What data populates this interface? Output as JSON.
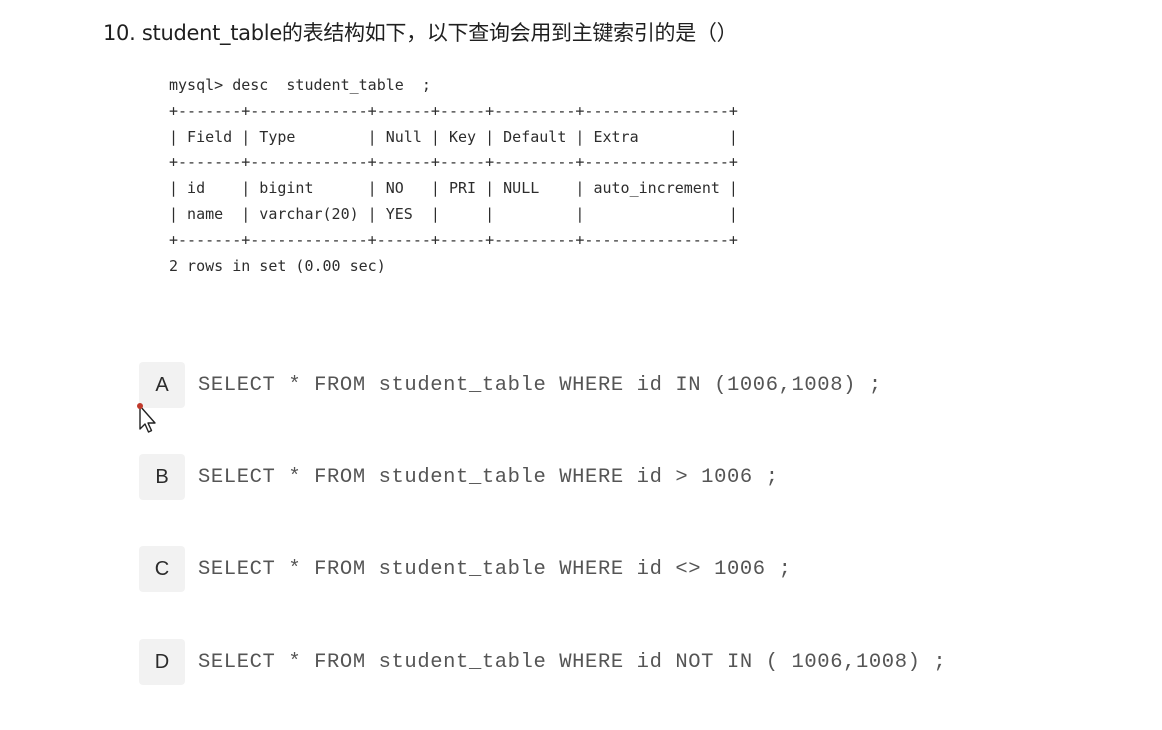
{
  "question": {
    "title": "10. student_table的表结构如下，以下查询会用到主键索引的是（）"
  },
  "console_output": {
    "lines": [
      "mysql> desc  student_table  ;",
      "+-------+-------------+------+-----+---------+----------------+",
      "| Field | Type        | Null | Key | Default | Extra          |",
      "+-------+-------------+------+-----+---------+----------------+",
      "| id    | bigint      | NO   | PRI | NULL    | auto_increment |",
      "| name  | varchar(20) | YES  |     |         |                |",
      "+-------+-------------+------+-----+---------+----------------+",
      "2 rows in set (0.00 sec)"
    ]
  },
  "options": [
    {
      "letter": "A",
      "text": "SELECT * FROM student_table WHERE id IN (1006,1008) ;"
    },
    {
      "letter": "B",
      "text": "SELECT * FROM student_table WHERE id > 1006 ;"
    },
    {
      "letter": "C",
      "text": "SELECT * FROM student_table WHERE id <> 1006 ;"
    },
    {
      "letter": "D",
      "text": "SELECT * FROM student_table WHERE id NOT IN ( 1006,1008) ;"
    }
  ],
  "colors": {
    "option_letter_bg": "#f2f2f2",
    "option_text": "#555555",
    "cursor_dot": "#c0392b"
  },
  "icons": {
    "cursor": "mouse-pointer-icon"
  }
}
